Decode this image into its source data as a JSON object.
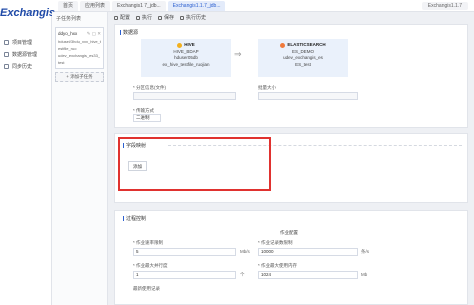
{
  "app": {
    "logo": "Exchangis"
  },
  "tabs": [
    {
      "label": "首页",
      "active": false
    },
    {
      "label": "应用列表",
      "active": false
    },
    {
      "label": "Exchangis1 7_jdb...",
      "active": false
    },
    {
      "label": "Exchangis1.1.7_jdb...",
      "active": true
    }
  ],
  "user": {
    "label": "Exchangis1.1.7"
  },
  "sidebar": {
    "items": [
      {
        "label": "项目管理"
      },
      {
        "label": "数据源管理"
      },
      {
        "label": "同步历史"
      }
    ]
  },
  "task_panel": {
    "title": "子任务列表",
    "task_name": "ddyo_hxx",
    "task_sub1": "hdusei/3hdu_xxx_hive_testfile_ruo",
    "task_sub2": "udev_exchangis_es33_test",
    "add_label": "添加子任务"
  },
  "toolbar": {
    "items": [
      "配置",
      "执行",
      "保存",
      "执行历史"
    ]
  },
  "data_section": {
    "title": "数据源",
    "source": {
      "type": "HIVE",
      "line1": "HIVE_BDAP",
      "line2": "hduser05db",
      "line3": "ex_hive_testfile_ruojian"
    },
    "target": {
      "type": "ELASTICSEARCH",
      "line1": "ES_DEMO",
      "line2": "udev_exchangis_es",
      "line3": "ES_test"
    },
    "arrow": "⇒",
    "left_label": "* 分区信息(文件)",
    "right_label": "批量大小",
    "left_value": "",
    "right_value": "",
    "mode_label": "* 传输方式",
    "mode_value": "二进制"
  },
  "mapping_section": {
    "title": "字段映射",
    "add_button": "添加"
  },
  "process_section": {
    "title": "过程控制",
    "center_title": "作业配置",
    "rows": [
      {
        "left_label": "* 作业速率限制",
        "left_value": "5",
        "left_unit": "Mb/s",
        "right_label": "* 作业记录数限制",
        "right_value": "10000",
        "right_unit": "条/s"
      },
      {
        "left_label": "* 作业最大并行度",
        "left_value": "1",
        "left_unit": "个",
        "right_label": "* 作业最大使用内存",
        "right_value": "1024",
        "right_unit": "Mb"
      }
    ],
    "last_label": "最新使用记录"
  },
  "colors": {
    "accent": "#2b5fd0",
    "highlight_border": "#e0322f",
    "node_bg": "#eaf1fb",
    "hive_icon": "#f2b01e",
    "es_icon": "#f07a3b"
  }
}
